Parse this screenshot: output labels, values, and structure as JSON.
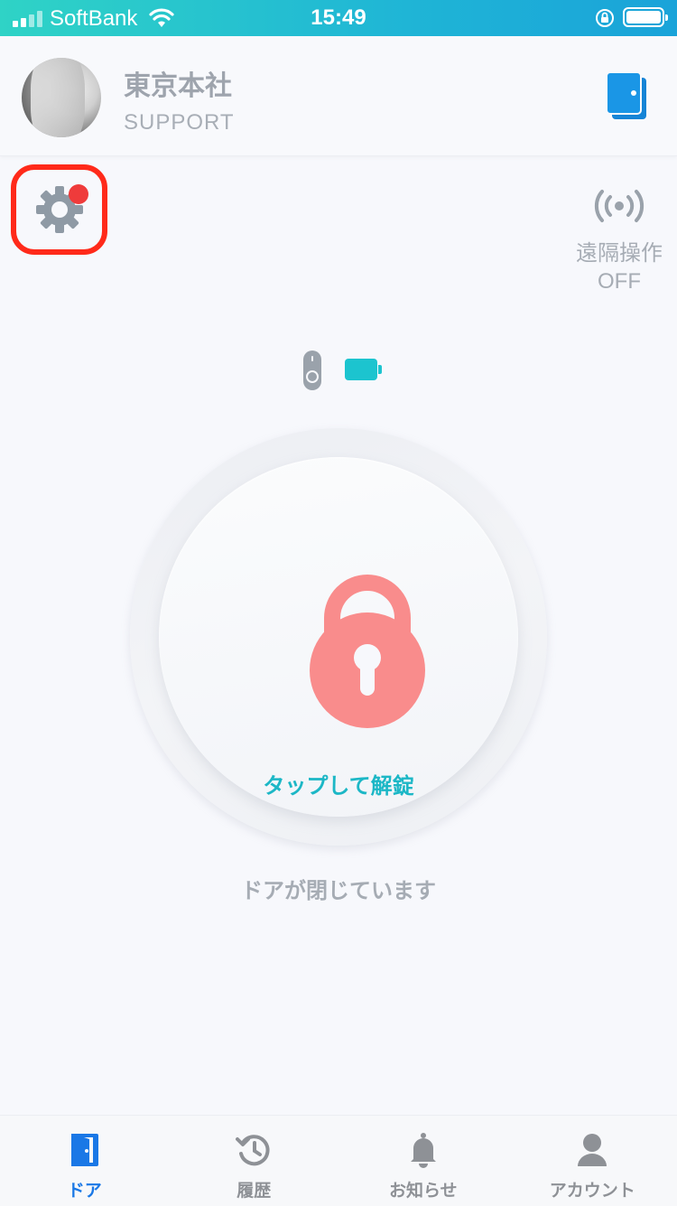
{
  "status_bar": {
    "carrier": "SoftBank",
    "time": "15:49"
  },
  "header": {
    "company": "東京本社",
    "role": "SUPPORT"
  },
  "remote_control": {
    "label": "遠隔操作",
    "state": "OFF"
  },
  "lock": {
    "action_label": "タップして解錠",
    "door_state": "ドアが閉じています",
    "lock_color": "#f98c8c",
    "accent_color": "#1cb7c6"
  },
  "tabs": [
    {
      "label": "ドア",
      "icon": "door-icon",
      "active": true
    },
    {
      "label": "履歴",
      "icon": "history-icon",
      "active": false
    },
    {
      "label": "お知らせ",
      "icon": "bell-icon",
      "active": false
    },
    {
      "label": "アカウント",
      "icon": "person-icon",
      "active": false
    }
  ]
}
